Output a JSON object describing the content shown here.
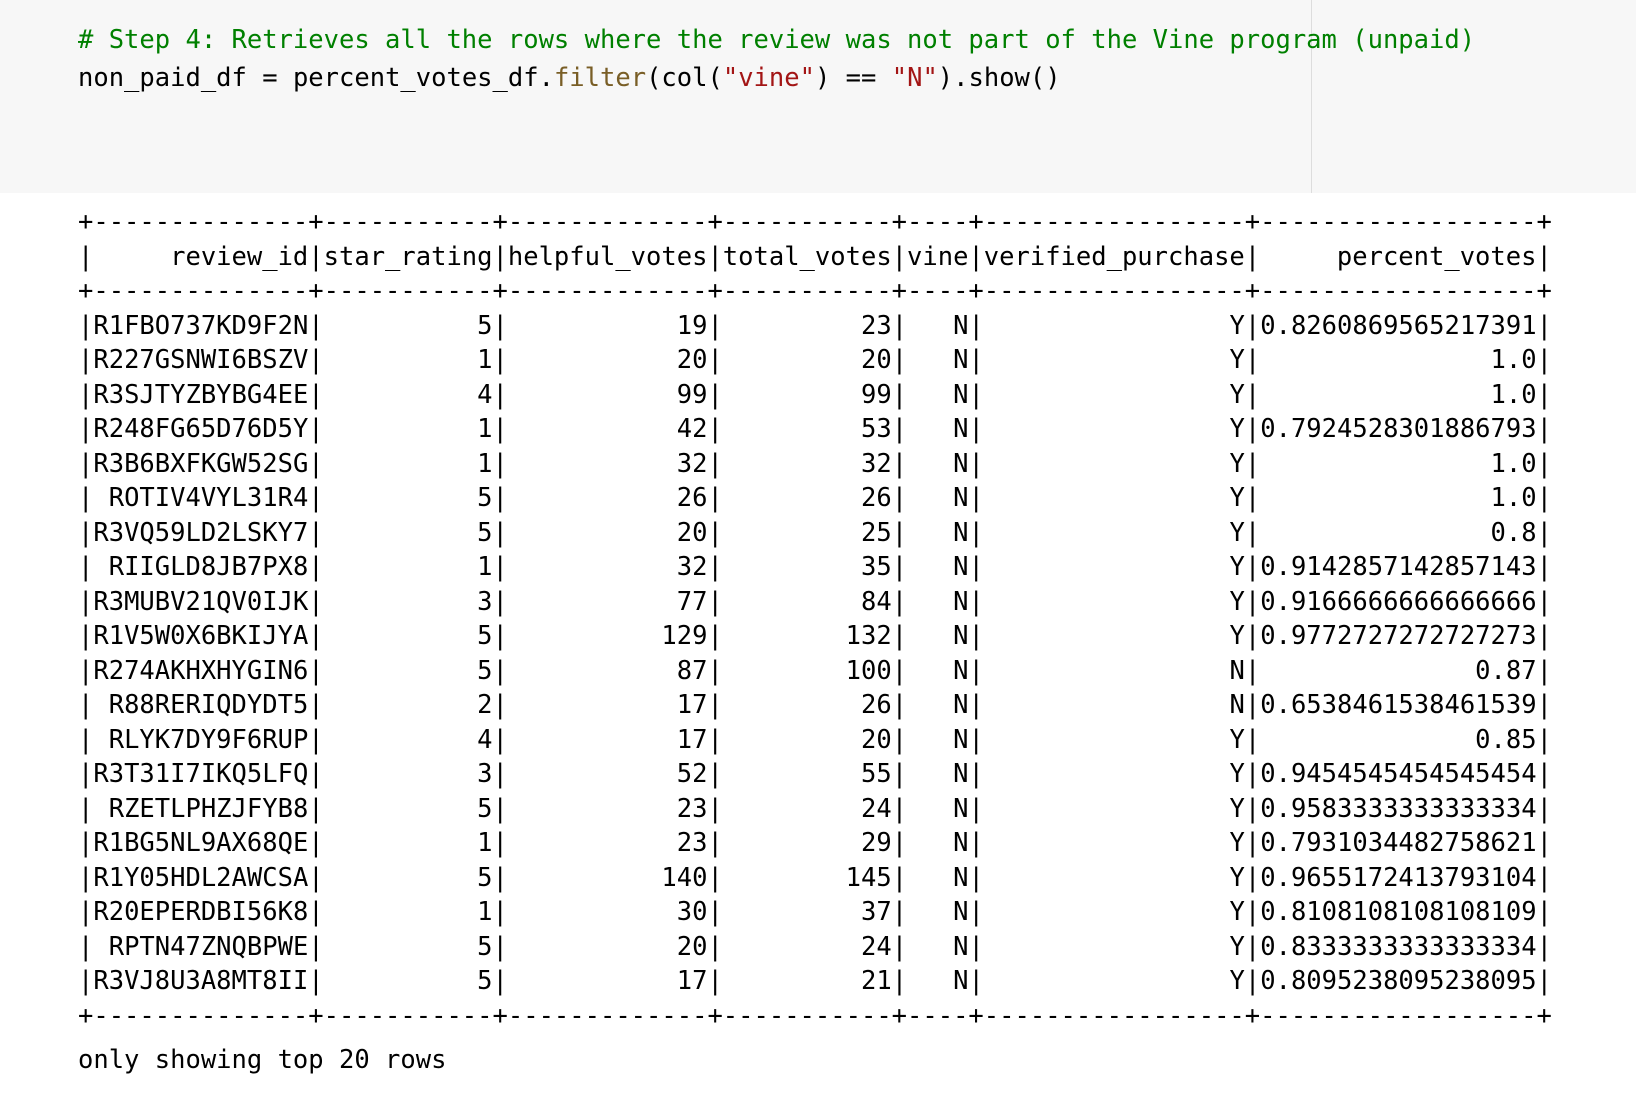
{
  "code": {
    "comment": "# Step 4: Retrieves all the rows where the review was not part of the Vine program (unpaid)",
    "line2": {
      "var": "non_paid_df",
      "assign": " = ",
      "obj": "percent_votes_df.",
      "method": "filter",
      "open": "(col(",
      "str1": "\"vine\"",
      "mid": ") == ",
      "str2": "\"N\"",
      "close": ").show()"
    }
  },
  "table": {
    "border": "+--------------+-----------+-------------+-----------+----+-----------------+------------------+",
    "header": "|     review_id|star_rating|helpful_votes|total_votes|vine|verified_purchase|     percent_votes|",
    "columns": [
      "review_id",
      "star_rating",
      "helpful_votes",
      "total_votes",
      "vine",
      "verified_purchase",
      "percent_votes"
    ],
    "rows": [
      [
        "R1FBO737KD9F2N",
        "5",
        "19",
        "23",
        "N",
        "Y",
        "0.8260869565217391"
      ],
      [
        "R227GSNWI6BSZV",
        "1",
        "20",
        "20",
        "N",
        "Y",
        "1.0"
      ],
      [
        "R3SJTYZBYBG4EE",
        "4",
        "99",
        "99",
        "N",
        "Y",
        "1.0"
      ],
      [
        "R248FG65D76D5Y",
        "1",
        "42",
        "53",
        "N",
        "Y",
        "0.7924528301886793"
      ],
      [
        "R3B6BXFKGW52SG",
        "1",
        "32",
        "32",
        "N",
        "Y",
        "1.0"
      ],
      [
        "ROTIV4VYL31R4",
        "5",
        "26",
        "26",
        "N",
        "Y",
        "1.0"
      ],
      [
        "R3VQ59LD2LSKY7",
        "5",
        "20",
        "25",
        "N",
        "Y",
        "0.8"
      ],
      [
        "RIIGLD8JB7PX8",
        "1",
        "32",
        "35",
        "N",
        "Y",
        "0.9142857142857143"
      ],
      [
        "R3MUBV21QV0IJK",
        "3",
        "77",
        "84",
        "N",
        "Y",
        "0.9166666666666666"
      ],
      [
        "R1V5W0X6BKIJYA",
        "5",
        "129",
        "132",
        "N",
        "Y",
        "0.9772727272727273"
      ],
      [
        "R274AKHXHYGIN6",
        "5",
        "87",
        "100",
        "N",
        "N",
        "0.87"
      ],
      [
        "R88RERIQDYDT5",
        "2",
        "17",
        "26",
        "N",
        "N",
        "0.6538461538461539"
      ],
      [
        "RLYK7DY9F6RUP",
        "4",
        "17",
        "20",
        "N",
        "Y",
        "0.85"
      ],
      [
        "R3T31I7IKQ5LFQ",
        "3",
        "52",
        "55",
        "N",
        "Y",
        "0.9454545454545454"
      ],
      [
        "RZETLPHZJFYB8",
        "5",
        "23",
        "24",
        "N",
        "Y",
        "0.9583333333333334"
      ],
      [
        "R1BG5NL9AX68QE",
        "1",
        "23",
        "29",
        "N",
        "Y",
        "0.7931034482758621"
      ],
      [
        "R1Y05HDL2AWCSA",
        "5",
        "140",
        "145",
        "N",
        "Y",
        "0.9655172413793104"
      ],
      [
        "R20EPERDBI56K8",
        "1",
        "30",
        "37",
        "N",
        "Y",
        "0.8108108108108109"
      ],
      [
        "RPTN47ZNQBPWE",
        "5",
        "20",
        "24",
        "N",
        "Y",
        "0.8333333333333334"
      ],
      [
        "R3VJ8U3A8MT8II",
        "5",
        "17",
        "21",
        "N",
        "Y",
        "0.8095238095238095"
      ]
    ]
  },
  "footer": "only showing top 20 rows"
}
